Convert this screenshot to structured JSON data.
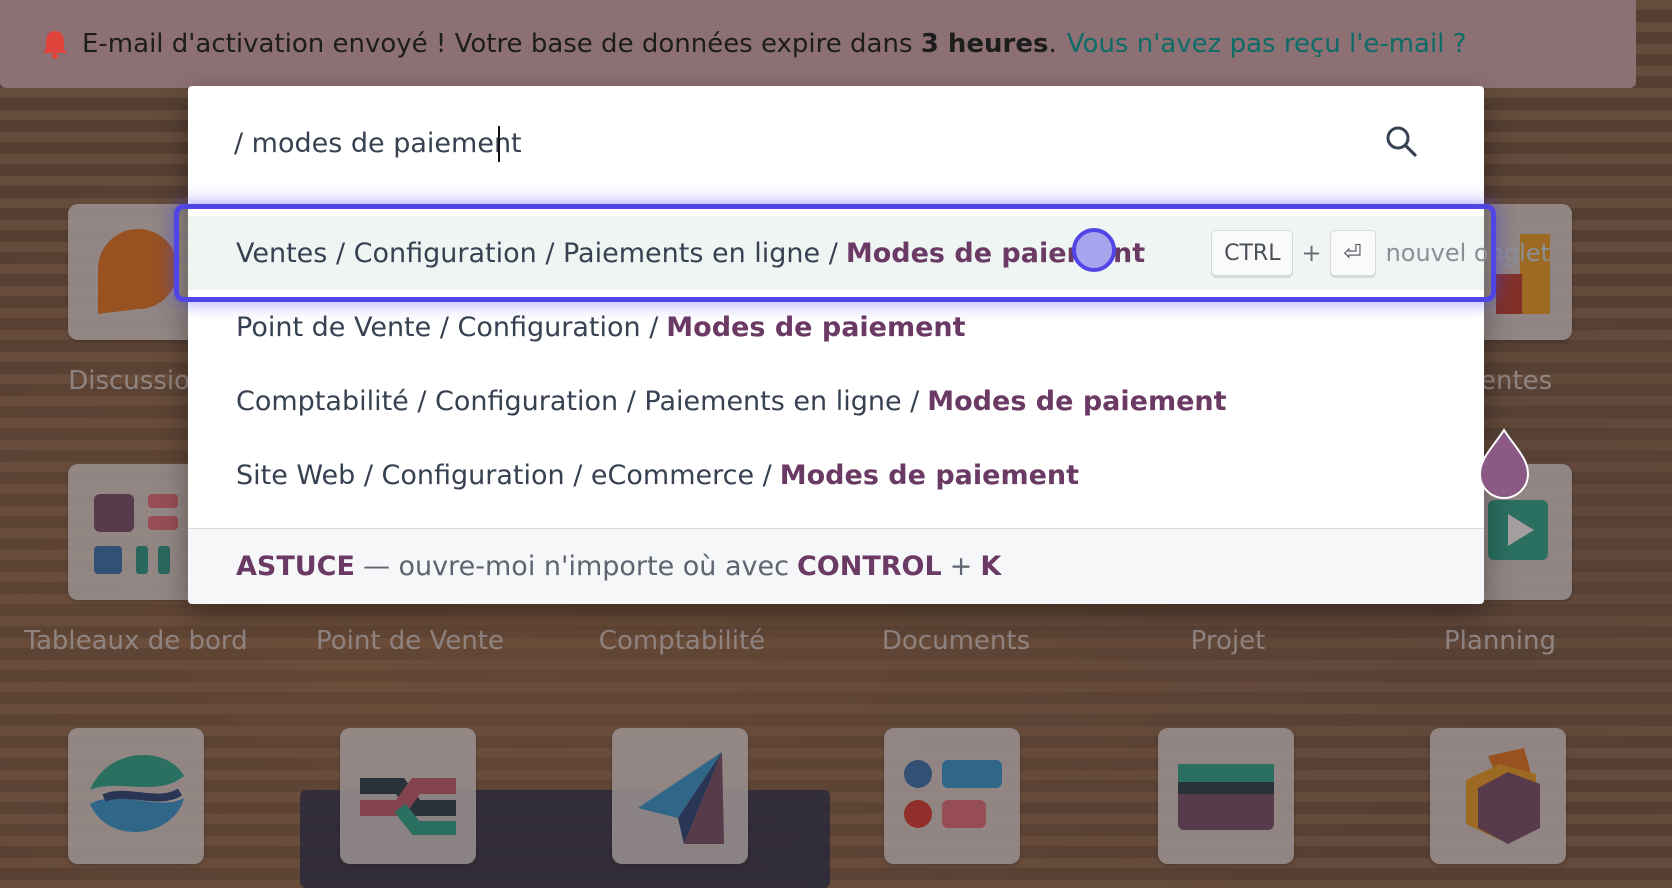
{
  "banner": {
    "text_before": "E-mail d'activation envoyé ! Votre base de données expire dans",
    "strong": "3 heures",
    "text_after": ".",
    "link": "Vous n'avez pas reçu l'e-mail ?"
  },
  "apps": {
    "row1": [
      {
        "label": "Discussion",
        "visible_label": "Discussio"
      },
      {
        "label": "Ventes",
        "visible_label": "entes"
      }
    ],
    "row2": [
      {
        "label": "Tableaux de bord"
      },
      {
        "label": "Point de Vente"
      },
      {
        "label": "Comptabilité"
      },
      {
        "label": "Documents"
      },
      {
        "label": "Projet"
      },
      {
        "label": "Planning"
      }
    ]
  },
  "palette": {
    "query": "/ modes de paiement",
    "results": [
      {
        "path": "Ventes / Configuration / Paiements en ligne /",
        "highlight": "Modes de paiement",
        "active": true
      },
      {
        "path": "Point de Vente / Configuration /",
        "highlight": "Modes de paiement"
      },
      {
        "path": "Comptabilité / Configuration / Paiements en ligne /",
        "highlight": "Modes de paiement"
      },
      {
        "path": "Site Web / Configuration / eCommerce /",
        "highlight": "Modes de paiement"
      }
    ],
    "hint": {
      "key1": "CTRL",
      "plus": "+",
      "key2": "⏎",
      "text": "nouvel onglet"
    },
    "footer": {
      "astuce": "ASTUCE",
      "text": "— ouvre-moi n'importe où avec",
      "key1": "CONTROL",
      "plus": "+",
      "key2": "K"
    }
  },
  "colors": {
    "accent": "#6b3a64",
    "link": "#0e6b66",
    "focus": "#5145e6",
    "active_row": "#eef5f3"
  }
}
